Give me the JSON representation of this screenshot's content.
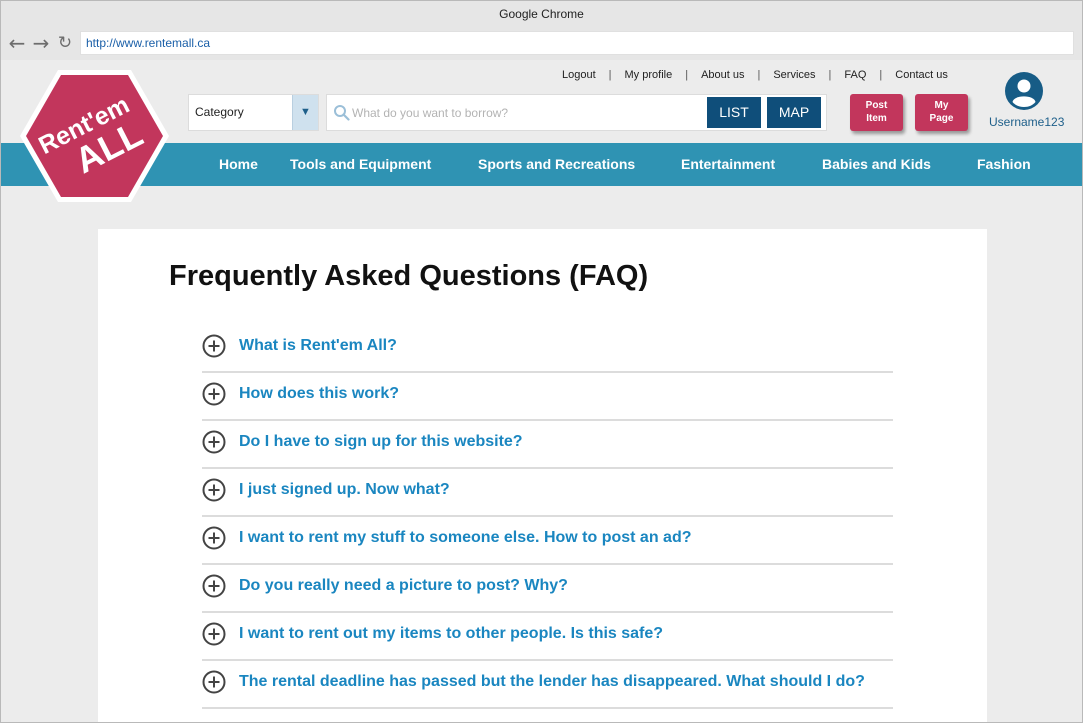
{
  "browser": {
    "title": "Google Chrome",
    "url": "http://www.rentemall.ca"
  },
  "logo": {
    "line1": "Rent'em",
    "line2": "ALL",
    "color": "#c2365c"
  },
  "toplinks": [
    "Logout",
    "My profile",
    "About us",
    "Services",
    "FAQ",
    "Contact us"
  ],
  "search": {
    "category_label": "Category",
    "placeholder": "What do you want to borrow?",
    "list_label": "LIST",
    "map_label": "MAP"
  },
  "actions": {
    "post_item": [
      "Post",
      "Item"
    ],
    "my_page": [
      "My",
      "Page"
    ]
  },
  "user": {
    "username": "Username123"
  },
  "nav": [
    "Home",
    "Tools and Equipment",
    "Sports and Recreations",
    "Entertainment",
    "Babies and Kids",
    "Fashion"
  ],
  "faq": {
    "title": "Frequently Asked Questions (FAQ)",
    "questions": [
      "What is Rent'em All?",
      "How does this work?",
      "Do I have to sign up for this website?",
      "I just signed up. Now what?",
      "I want to rent my stuff to someone else. How to post an ad?",
      "Do you really need a picture to post? Why?",
      "I want to rent out my items to other people. Is this safe?",
      "The rental deadline has passed but the lender has disappeared. What should I do?"
    ]
  },
  "colors": {
    "accent": "#2f93b3",
    "brand": "#c2365c",
    "dark_button": "#0f4e7a",
    "link": "#1a86c0"
  }
}
